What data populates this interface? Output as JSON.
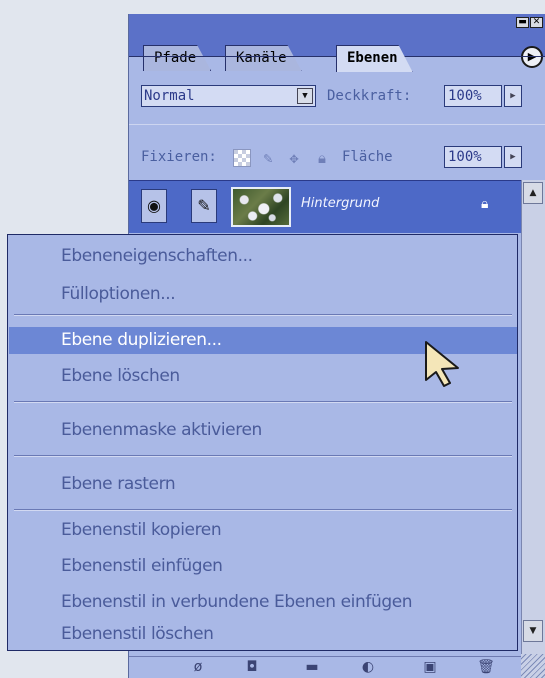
{
  "palette": {
    "tabs": [
      "Pfade",
      "Kanäle",
      "Ebenen"
    ],
    "active_tab": "Ebenen",
    "blend_mode": "Normal",
    "opacity_label": "Deckkraft:",
    "opacity_value": "100%",
    "lock_label": "Fixieren:",
    "fill_label": "Fläche",
    "fill_value": "100%",
    "layer_name": "Hintergrund"
  },
  "context_menu": {
    "items": [
      "Ebeneneigenschaften...",
      "Fülloptionen...",
      "Ebene duplizieren...",
      "Ebene löschen",
      "Ebenenmaske aktivieren",
      "Ebene rastern",
      "Ebenenstil kopieren",
      "Ebenenstil einfügen",
      "Ebenenstil in verbundene Ebenen einfügen",
      "Ebenenstil löschen"
    ],
    "highlighted": "Ebene duplizieren..."
  },
  "colors": {
    "palette_bg": "#a9b8e6",
    "title_blue": "#5b71c8",
    "highlight": "#6c87d5",
    "menu_text": "#4a5b9a"
  },
  "icons": [
    "minimize-icon",
    "close-icon",
    "palette-menu-icon",
    "dropdown-arrow-icon",
    "stepper-arrow-icon",
    "lock-transparency-icon",
    "lock-paint-icon",
    "lock-move-icon",
    "lock-all-icon",
    "eye-icon",
    "brush-icon",
    "layer-lock-icon",
    "scroll-up-icon",
    "scroll-down-icon",
    "cursor-arrow-icon"
  ]
}
